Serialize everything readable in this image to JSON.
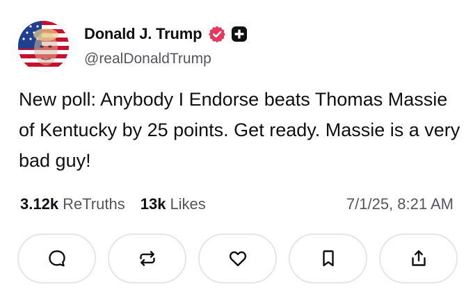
{
  "author": {
    "display_name": "Donald J. Trump",
    "handle": "@realDonaldTrump",
    "verified_badge_color": "#e8365d",
    "avatar_icon": "profile-avatar"
  },
  "post": {
    "text": "New poll: Anybody I Endorse beats Thomas Massie of Kentucky by 25 points. Get ready. Massie is a very bad guy!"
  },
  "stats": {
    "retruths_count": "3.12k",
    "retruths_label": "ReTruths",
    "likes_count": "13k",
    "likes_label": "Likes",
    "timestamp": "7/1/25, 8:21 AM"
  },
  "actions": [
    {
      "icon": "comment-icon"
    },
    {
      "icon": "retruth-icon"
    },
    {
      "icon": "like-icon"
    },
    {
      "icon": "bookmark-icon"
    },
    {
      "icon": "share-icon"
    }
  ],
  "colors": {
    "text_primary": "#0f0f14",
    "text_secondary": "#55555f",
    "button_border": "#e6e6ea"
  }
}
